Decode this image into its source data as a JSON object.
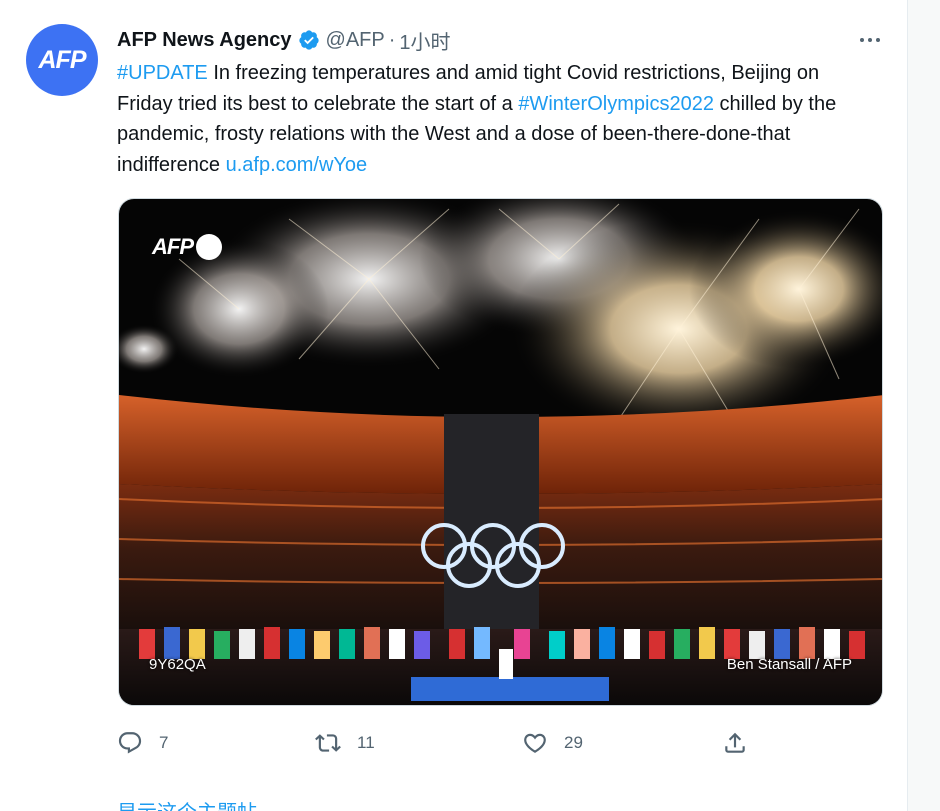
{
  "tweet": {
    "avatar_text": "AFP",
    "display_name": "AFP News Agency",
    "handle": "@AFP",
    "separator": "·",
    "time": "1小时",
    "text": {
      "hashtag1": "#UPDATE",
      "part1": " In freezing temperatures and amid tight Covid restrictions, Beijing on Friday tried its best to celebrate the start of a ",
      "hashtag2": "#WinterOlympics2022",
      "part2": " chilled by the pandemic, frosty relations with the West and a dose of been-there-done-that indifference ",
      "link": "u.afp.com/wYoe"
    },
    "media": {
      "watermark": "AFP",
      "photo_code": "9Y62QA",
      "photo_credit": "Ben Stansall / AFP"
    },
    "actions": {
      "replies": "7",
      "retweets": "11",
      "likes": "29"
    },
    "show_thread": "显示这个主题帖"
  },
  "colors": {
    "link": "#1d9bf0",
    "secondary_text": "#536471",
    "avatar_bg": "#3d72f3",
    "verified": "#1d9bf0"
  },
  "icons": [
    "verified-badge-icon",
    "more-icon",
    "reply-icon",
    "retweet-icon",
    "like-icon",
    "share-icon"
  ]
}
